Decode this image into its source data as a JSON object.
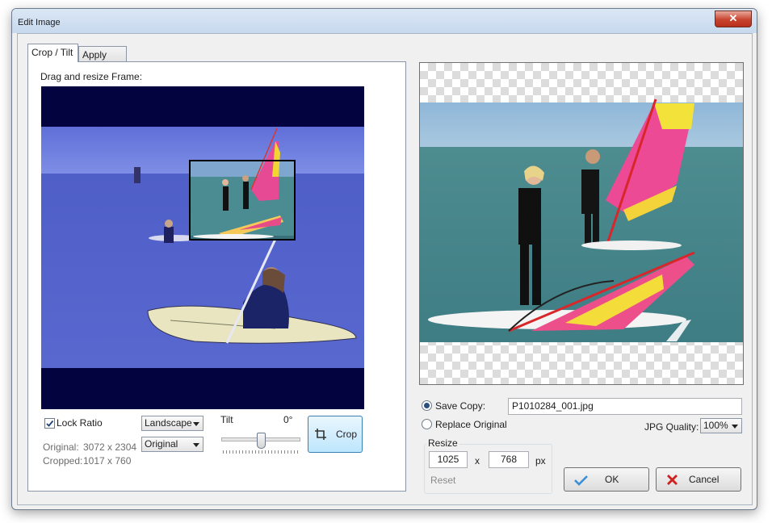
{
  "window": {
    "title": "Edit Image",
    "close_symbol": "✕"
  },
  "tabs": [
    {
      "label": "Crop / Tilt",
      "active": true
    },
    {
      "label": "Apply Filter",
      "active": false
    }
  ],
  "crop": {
    "instruction": "Drag and resize Frame:",
    "lock_ratio_label": "Lock Ratio",
    "lock_ratio_checked": true,
    "orientation_value": "Landscape",
    "size_value": "Original",
    "original_label": "Original:",
    "original_value": "3072 x 2304",
    "cropped_label": "Cropped:",
    "cropped_value": "1017 x 760",
    "tilt_label": "Tilt",
    "tilt_value": "0°",
    "tilt_level": 0.5,
    "crop_button": "Crop"
  },
  "save": {
    "save_copy_label": "Save Copy:",
    "save_copy_selected": true,
    "filename": "P1010284_001.jpg",
    "replace_original_label": "Replace Original",
    "jpg_quality_label": "JPG Quality:",
    "jpg_quality_value": "100%"
  },
  "resize": {
    "group_label": "Resize",
    "width": "1025",
    "separator": "x",
    "height": "768",
    "unit": "px",
    "reset_label": "Reset"
  },
  "actions": {
    "ok_label": "OK",
    "cancel_label": "Cancel"
  },
  "colors": {
    "accent": "#3c7fb1",
    "ok_check": "#3a8fd8",
    "cancel_x": "#d01f1f",
    "frame_bg": "#030340"
  }
}
